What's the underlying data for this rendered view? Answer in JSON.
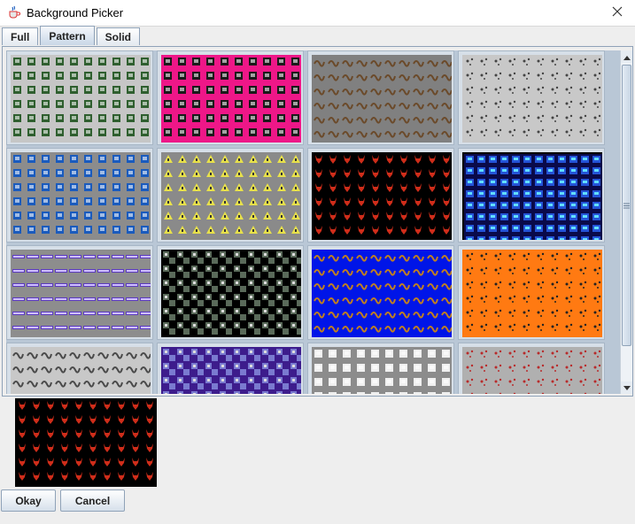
{
  "window": {
    "title": "Background Picker"
  },
  "tabs": [
    {
      "label": "Full",
      "active": false
    },
    {
      "label": "Pattern",
      "active": true
    },
    {
      "label": "Solid",
      "active": false
    }
  ],
  "patterns": [
    {
      "name": "green-box-tile",
      "bg": "#c6c6c6",
      "fg": "#2f5f2f",
      "shape": "box"
    },
    {
      "name": "magenta-mask-tile",
      "bg": "#ee1788",
      "fg": "#1a1a1a",
      "shape": "box"
    },
    {
      "name": "brown-critter-tile",
      "bg": "#808080",
      "fg": "#6b4a2a",
      "shape": "squiggle"
    },
    {
      "name": "gray-dots-tile",
      "bg": "#c8c8c8",
      "fg": "#444444",
      "shape": "dots"
    },
    {
      "name": "blue-computer-tile",
      "bg": "#8c8c8c",
      "fg": "#1a5bbd",
      "shape": "box"
    },
    {
      "name": "yellow-triangle-tile",
      "bg": "#8a8a8a",
      "fg": "#e8e14a",
      "shape": "triangle"
    },
    {
      "name": "red-devil-tile",
      "bg": "#000000",
      "fg": "#d02d1a",
      "shape": "devil"
    },
    {
      "name": "blue-square-tile",
      "bg": "#000000",
      "fg": "#2454d8",
      "shape": "grid"
    },
    {
      "name": "purple-bar-tile",
      "bg": "#8d8d8d",
      "fg": "#5c3bbf",
      "shape": "bar"
    },
    {
      "name": "green-check-tile",
      "bg": "#000000",
      "fg": "#5a6a5a",
      "shape": "checker"
    },
    {
      "name": "blue-bug-tile",
      "bg": "#0015e8",
      "fg": "#c08020",
      "shape": "squiggle"
    },
    {
      "name": "orange-eye-tile",
      "bg": "#ff7a12",
      "fg": "#222222",
      "shape": "dots"
    },
    {
      "name": "gray-bird-tile",
      "bg": "#c8c8c8",
      "fg": "#4a4a4a",
      "shape": "squiggle"
    },
    {
      "name": "purple-weave-tile",
      "bg": "#3d1c8c",
      "fg": "#7a7ad0",
      "shape": "checker"
    },
    {
      "name": "white-horse-tile",
      "bg": "#8c8c8c",
      "fg": "#f0f0f0",
      "shape": "box"
    },
    {
      "name": "red-dot-tile",
      "bg": "#b0b0b0",
      "fg": "#b82b2b",
      "shape": "dots"
    }
  ],
  "preview": {
    "name": "red-devil-tile",
    "bg": "#000000",
    "fg": "#d02d1a",
    "shape": "devil"
  },
  "buttons": {
    "okay": "Okay",
    "cancel": "Cancel"
  },
  "icons": {
    "app": "java-cup-icon",
    "close": "close-icon",
    "up": "arrow-up-icon",
    "down": "arrow-down-icon"
  }
}
